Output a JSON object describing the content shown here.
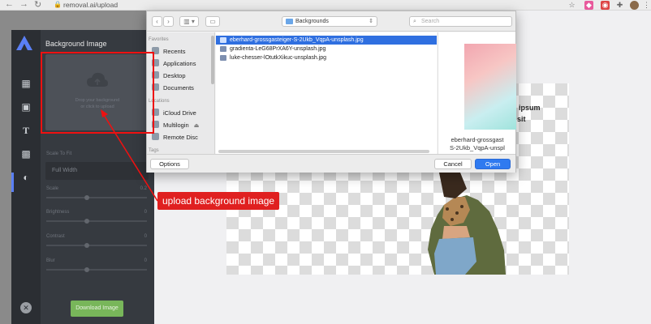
{
  "browser": {
    "back_icon": "back-arrow-icon",
    "forward_icon": "forward-arrow-icon",
    "reload_icon": "reload-icon",
    "url": "removal.ai/upload"
  },
  "panel": {
    "title": "Background Image",
    "upload_hint_line1": "Drop your background",
    "upload_hint_line2": "or click to upload",
    "scale_label": "Scale To Fit",
    "select_value": "Full Width",
    "controls": [
      {
        "label": "Scale",
        "value": "0.2"
      },
      {
        "label": "Brightness",
        "value": "0"
      },
      {
        "label": "Contrast",
        "value": "0"
      },
      {
        "label": "Blur",
        "value": "0"
      }
    ],
    "download_label": "Download Image",
    "close_glyph": "✕"
  },
  "canvas": {
    "line1": "n ipsum",
    "line2": "sit"
  },
  "dialog": {
    "location": "Backgrounds",
    "search_placeholder": "Search",
    "sidebar": {
      "favorites_heading": "Favorites",
      "favorites": [
        "Recents",
        "Applications",
        "Desktop",
        "Documents"
      ],
      "locations_heading": "Locations",
      "locations": [
        "iCloud Drive",
        "Multilogin",
        "Remote Disc"
      ],
      "tags_heading": "Tags"
    },
    "files": [
      "eberhard-grossgasteiger-S-2Ukb_VqpA-unsplash.jpg",
      "gradienta-LeG68PrXA6Y-unsplash.jpg",
      "luke-chesser-lOtutkXikuc-unsplash.jpg"
    ],
    "preview_name_line1": "eberhard-grossgast",
    "preview_name_line2": "S-2Ukb_VqpA-unspl",
    "options_label": "Options",
    "cancel_label": "Cancel",
    "open_label": "Open"
  },
  "annotation": {
    "label": "upload background image",
    "color": "#e02020"
  },
  "colors": {
    "rail": "#2b2e33",
    "panel": "#363a40",
    "download_button": "#78b65a",
    "selection": "#2f6fe0",
    "primary_button": "#2f7af0"
  }
}
